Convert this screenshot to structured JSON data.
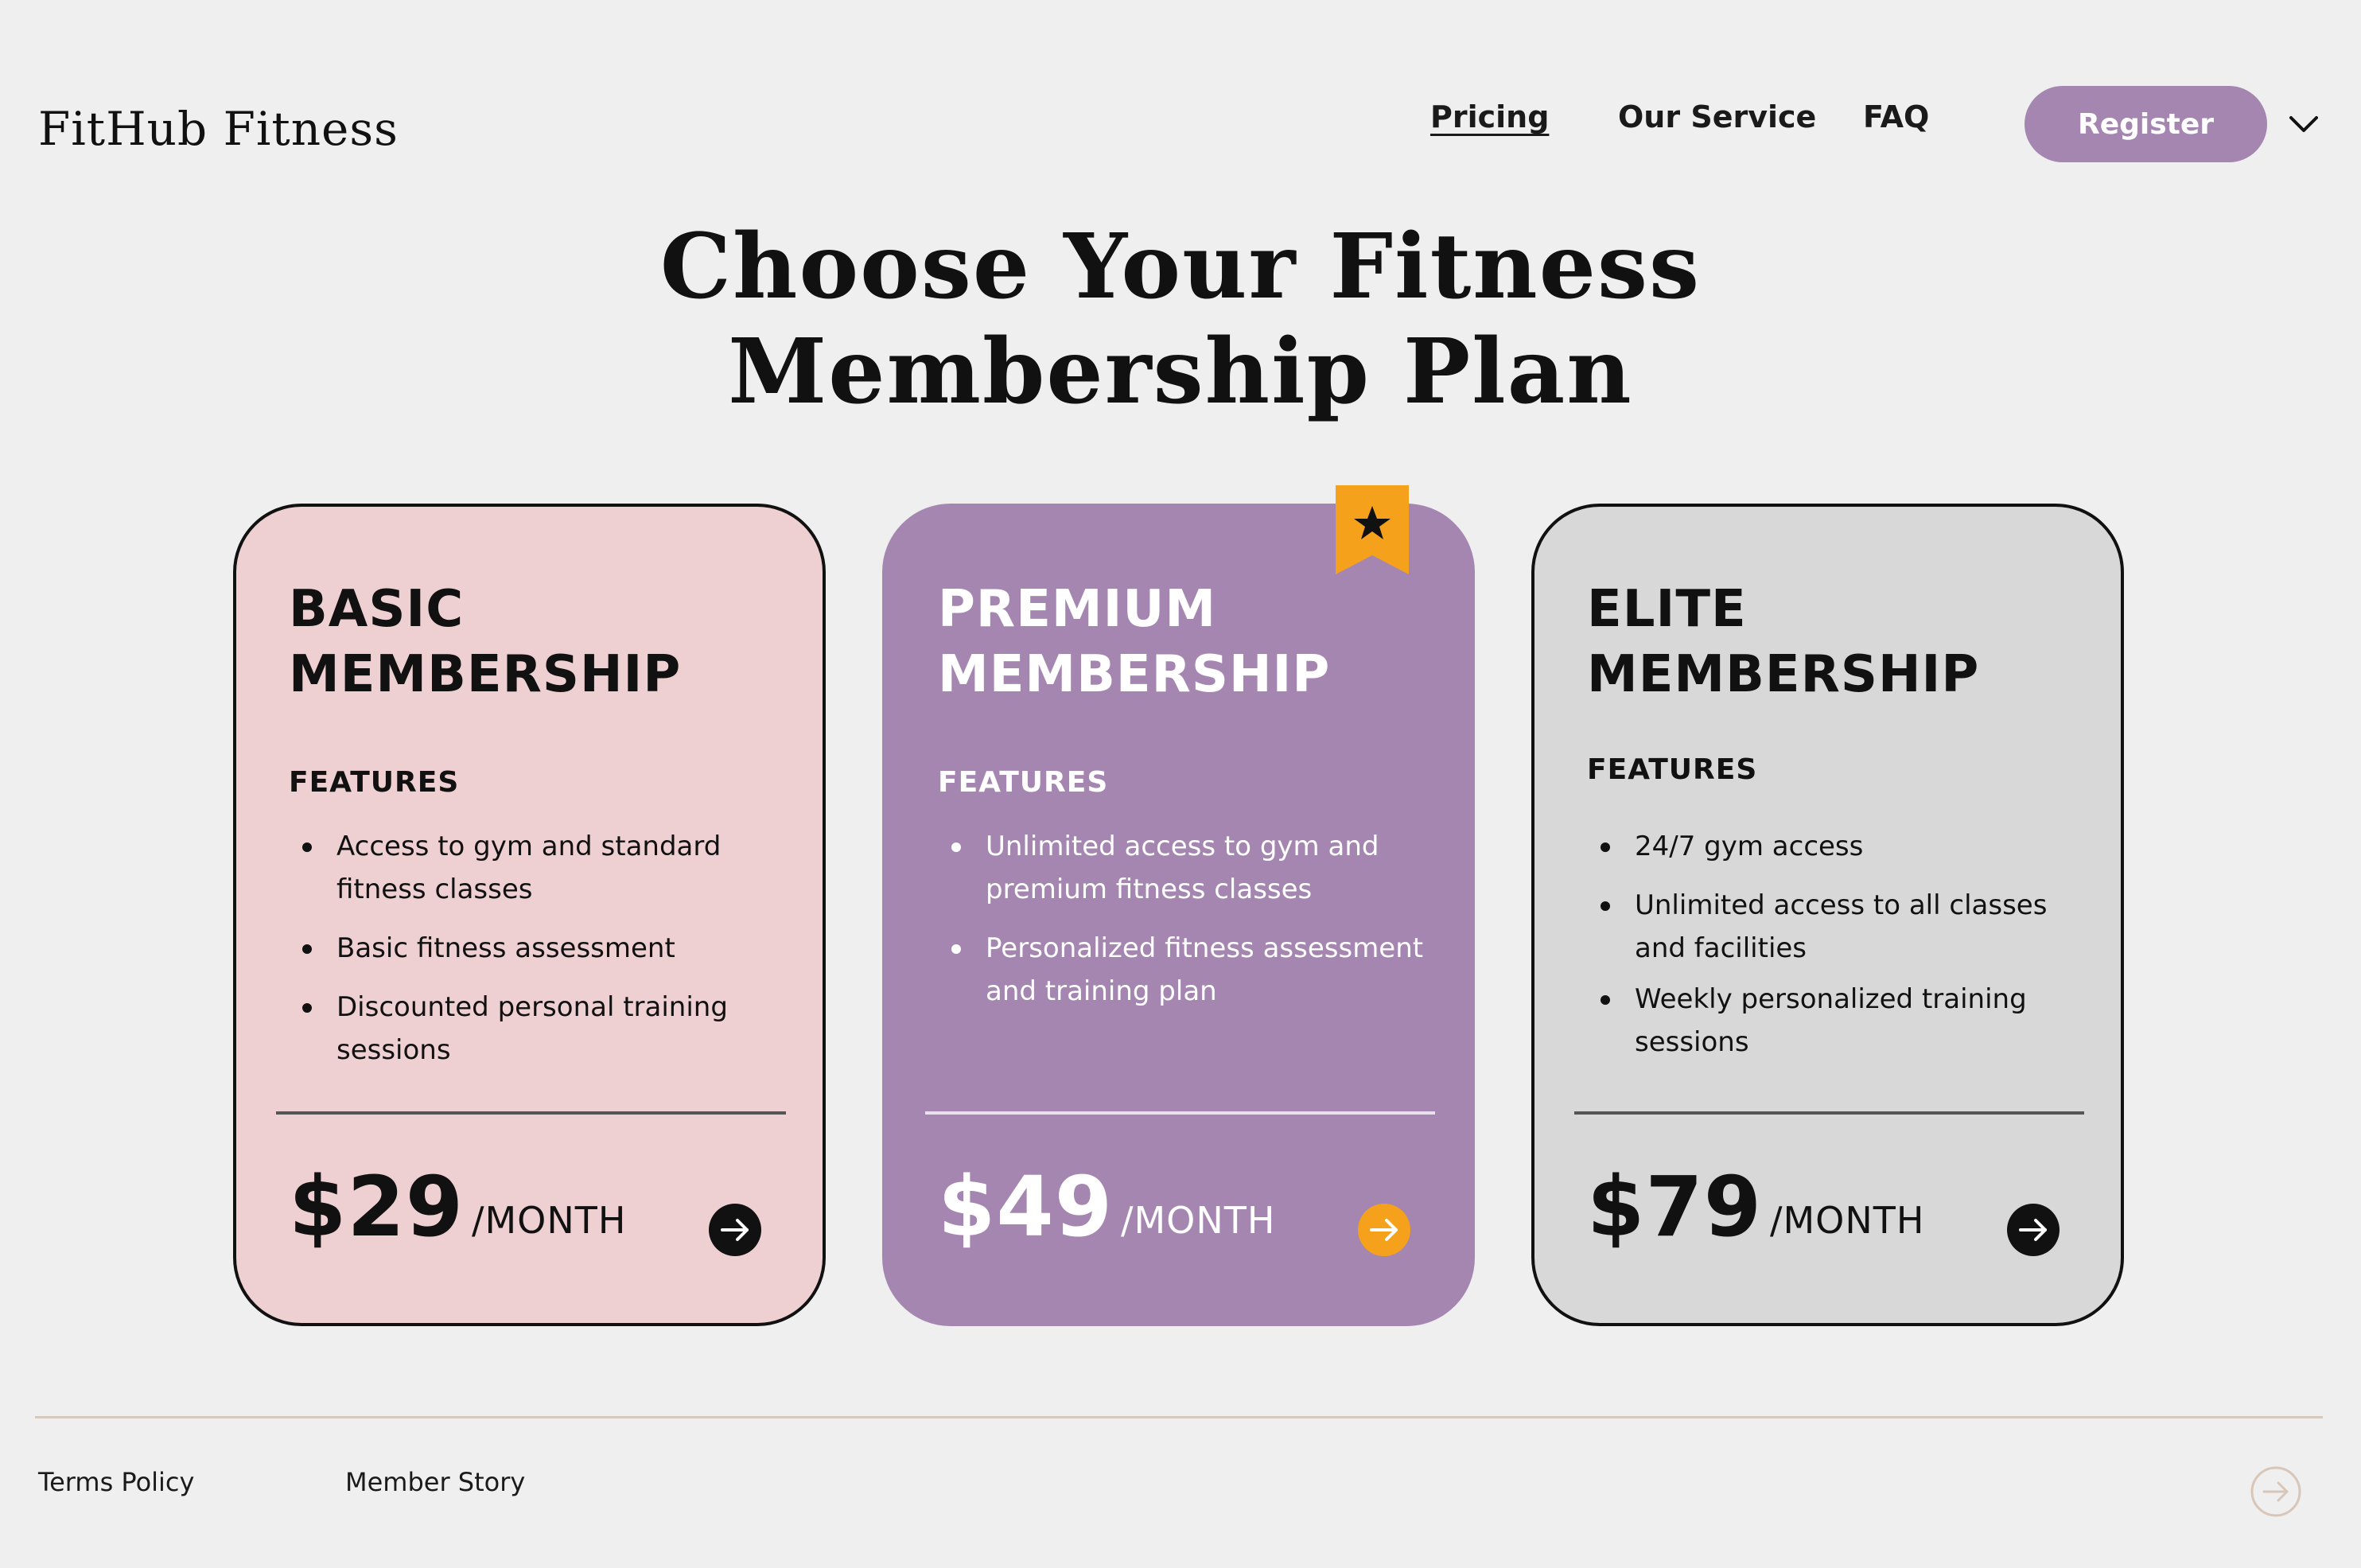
{
  "header": {
    "brand": "FitHub Fitness",
    "nav": {
      "pricing": "Pricing",
      "our_service": "Our Service",
      "faq": "FAQ"
    },
    "register_label": "Register",
    "dropdown_icon": "chevron-down-icon"
  },
  "hero": {
    "title_line1": "Choose Your Fitness",
    "title_line2": "Membership Plan"
  },
  "plans": [
    {
      "title_line1": "BASIC",
      "title_line2": "MEMBERSHIP",
      "features_label": "FEATURES",
      "features": [
        "Access to gym and standard fitness classes",
        "Basic fitness assessment",
        "Discounted personal training sessions"
      ],
      "price": "$29",
      "period": "/MONTH",
      "background": "#eed0d2",
      "arrow_color": "#111111"
    },
    {
      "title_line1": "PREMIUM",
      "title_line2": "MEMBERSHIP",
      "features_label": "FEATURES",
      "features": [
        "Unlimited access to gym and premium fitness classes",
        "Personalized fitness assessment and training plan"
      ],
      "price": "$49",
      "period": "/MONTH",
      "background": "#a486b1",
      "arrow_color": "#f5a11c",
      "featured_badge_icon": "star-ribbon-icon"
    },
    {
      "title_line1": "ELITE",
      "title_line2": "MEMBERSHIP",
      "features_label": "FEATURES",
      "features": [
        "24/7 gym access",
        "Unlimited access to all classes and facilities",
        "Weekly personalized training sessions"
      ],
      "price": "$79",
      "period": "/MONTH",
      "background": "#d8d8d8",
      "arrow_color": "#111111"
    }
  ],
  "footer": {
    "terms": "Terms Policy",
    "member_story": "Member Story",
    "next_icon": "arrow-circle-right-icon"
  },
  "colors": {
    "page_background": "#efefef",
    "accent_purple": "#a486b1",
    "accent_orange": "#f5a11c",
    "text_dark": "#111111"
  }
}
